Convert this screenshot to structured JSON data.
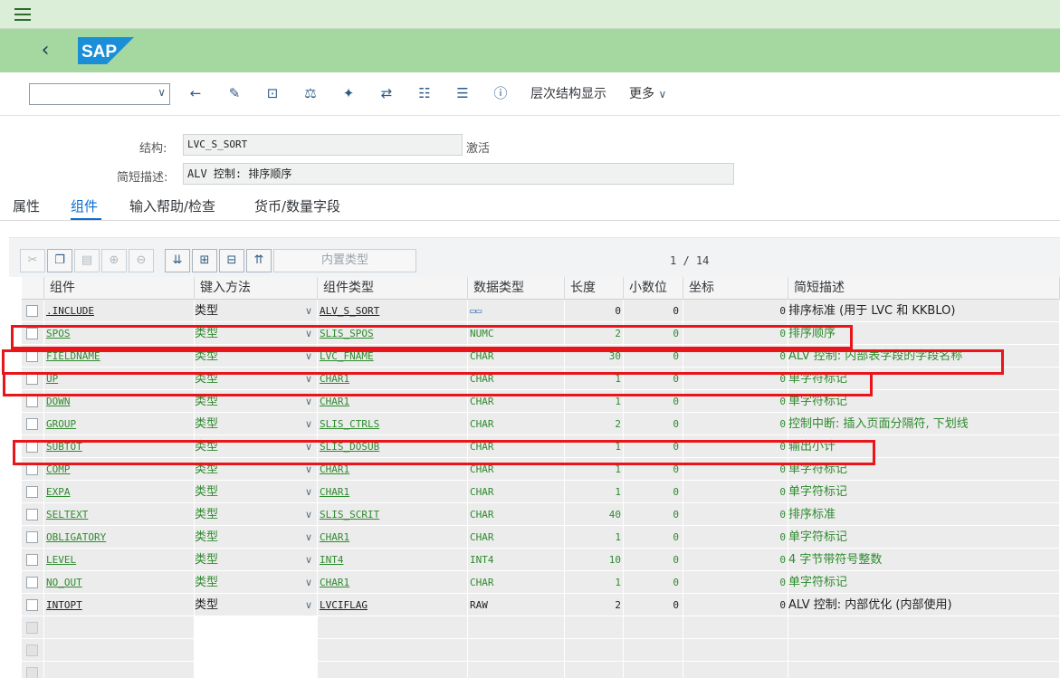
{
  "toolbar": {
    "select_value": "",
    "hierarchy_label": "层次结构显示",
    "more_label": "更多"
  },
  "form": {
    "structure_label": "结构:",
    "structure_value": "LVC_S_SORT",
    "status": "激活",
    "desc_label": "简短描述:",
    "desc_value": "ALV 控制: 排序顺序"
  },
  "tabs": [
    {
      "label": "属性",
      "active": false
    },
    {
      "label": "组件",
      "active": true
    },
    {
      "label": "输入帮助/检查",
      "active": false
    },
    {
      "label": "货币/数量字段",
      "active": false
    }
  ],
  "table_toolbar": {
    "builtin_type_label": "内置类型",
    "pager": "1 / 14"
  },
  "columns": [
    "组件",
    "键入方法",
    "组件类型",
    "数据类型",
    "长度",
    "小数位",
    "坐标",
    "简短描述"
  ],
  "rows": [
    {
      "name": ".INCLUDE",
      "method": "类型",
      "comptype": "ALV_S_SORT",
      "dtype": "",
      "len": "0",
      "dec": "0",
      "coord": "0",
      "desc": "排序标准 (用于 LVC 和 KKBLO)",
      "color": "black",
      "include": true
    },
    {
      "name": "SPOS",
      "method": "类型",
      "comptype": "SLIS_SPOS",
      "dtype": "NUMC",
      "len": "2",
      "dec": "0",
      "coord": "0",
      "desc": "排序顺序",
      "color": "green"
    },
    {
      "name": "FIELDNAME",
      "method": "类型",
      "comptype": "LVC_FNAME",
      "dtype": "CHAR",
      "len": "30",
      "dec": "0",
      "coord": "0",
      "desc": "ALV 控制: 内部表字段的字段名称",
      "color": "green"
    },
    {
      "name": "UP",
      "method": "类型",
      "comptype": "CHAR1",
      "dtype": "CHAR",
      "len": "1",
      "dec": "0",
      "coord": "0",
      "desc": "单字符标记",
      "color": "green"
    },
    {
      "name": "DOWN",
      "method": "类型",
      "comptype": "CHAR1",
      "dtype": "CHAR",
      "len": "1",
      "dec": "0",
      "coord": "0",
      "desc": "单字符标记",
      "color": "green"
    },
    {
      "name": "GROUP",
      "method": "类型",
      "comptype": "SLIS_CTRLS",
      "dtype": "CHAR",
      "len": "2",
      "dec": "0",
      "coord": "0",
      "desc": "控制中断: 插入页面分隔符, 下划线",
      "color": "green"
    },
    {
      "name": "SUBTOT",
      "method": "类型",
      "comptype": "SLIS_DOSUB",
      "dtype": "CHAR",
      "len": "1",
      "dec": "0",
      "coord": "0",
      "desc": "输出小计",
      "color": "green"
    },
    {
      "name": "COMP",
      "method": "类型",
      "comptype": "CHAR1",
      "dtype": "CHAR",
      "len": "1",
      "dec": "0",
      "coord": "0",
      "desc": "单字符标记",
      "color": "green"
    },
    {
      "name": "EXPA",
      "method": "类型",
      "comptype": "CHAR1",
      "dtype": "CHAR",
      "len": "1",
      "dec": "0",
      "coord": "0",
      "desc": "单字符标记",
      "color": "green"
    },
    {
      "name": "SELTEXT",
      "method": "类型",
      "comptype": "SLIS_SCRIT",
      "dtype": "CHAR",
      "len": "40",
      "dec": "0",
      "coord": "0",
      "desc": "排序标准",
      "color": "green"
    },
    {
      "name": "OBLIGATORY",
      "method": "类型",
      "comptype": "CHAR1",
      "dtype": "CHAR",
      "len": "1",
      "dec": "0",
      "coord": "0",
      "desc": "单字符标记",
      "color": "green"
    },
    {
      "name": "LEVEL",
      "method": "类型",
      "comptype": "INT4",
      "dtype": "INT4",
      "len": "10",
      "dec": "0",
      "coord": "0",
      "desc": "4 字节带符号整数",
      "color": "green"
    },
    {
      "name": "NO_OUT",
      "method": "类型",
      "comptype": "CHAR1",
      "dtype": "CHAR",
      "len": "1",
      "dec": "0",
      "coord": "0",
      "desc": "单字符标记",
      "color": "green"
    },
    {
      "name": "INTOPT",
      "method": "类型",
      "comptype": "LVCIFLAG",
      "dtype": "RAW",
      "len": "2",
      "dec": "0",
      "coord": "0",
      "desc": "ALV 控制: 内部优化 (内部使用)",
      "color": "black"
    }
  ],
  "colors": {
    "header_green": "#a5d7a1",
    "menubar_green": "#dbeed7",
    "highlight_red": "#e8151b",
    "data_green": "#2e8b2e"
  }
}
